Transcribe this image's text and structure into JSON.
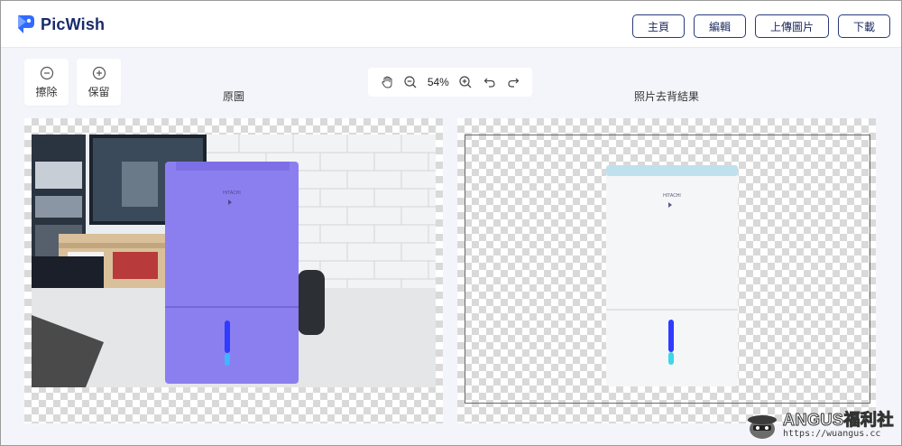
{
  "app": {
    "name": "PicWish"
  },
  "nav": {
    "home": "主頁",
    "edit": "編輯",
    "upload": "上傳圖片",
    "download": "下載"
  },
  "tools": {
    "erase": "擦除",
    "keep": "保留"
  },
  "zoom": {
    "value": "54%"
  },
  "captions": {
    "original": "原圖",
    "result": "照片去背結果"
  },
  "product": {
    "brand": "HITACHI"
  },
  "watermark": {
    "title": "ANGUS福利社",
    "url": "https://wuangus.cc"
  },
  "colors": {
    "brand_navy": "#1a2b6b",
    "accent_blue": "#2f6bff",
    "device_purple": "#8b7ff0",
    "checker": "#d9d9d9"
  }
}
